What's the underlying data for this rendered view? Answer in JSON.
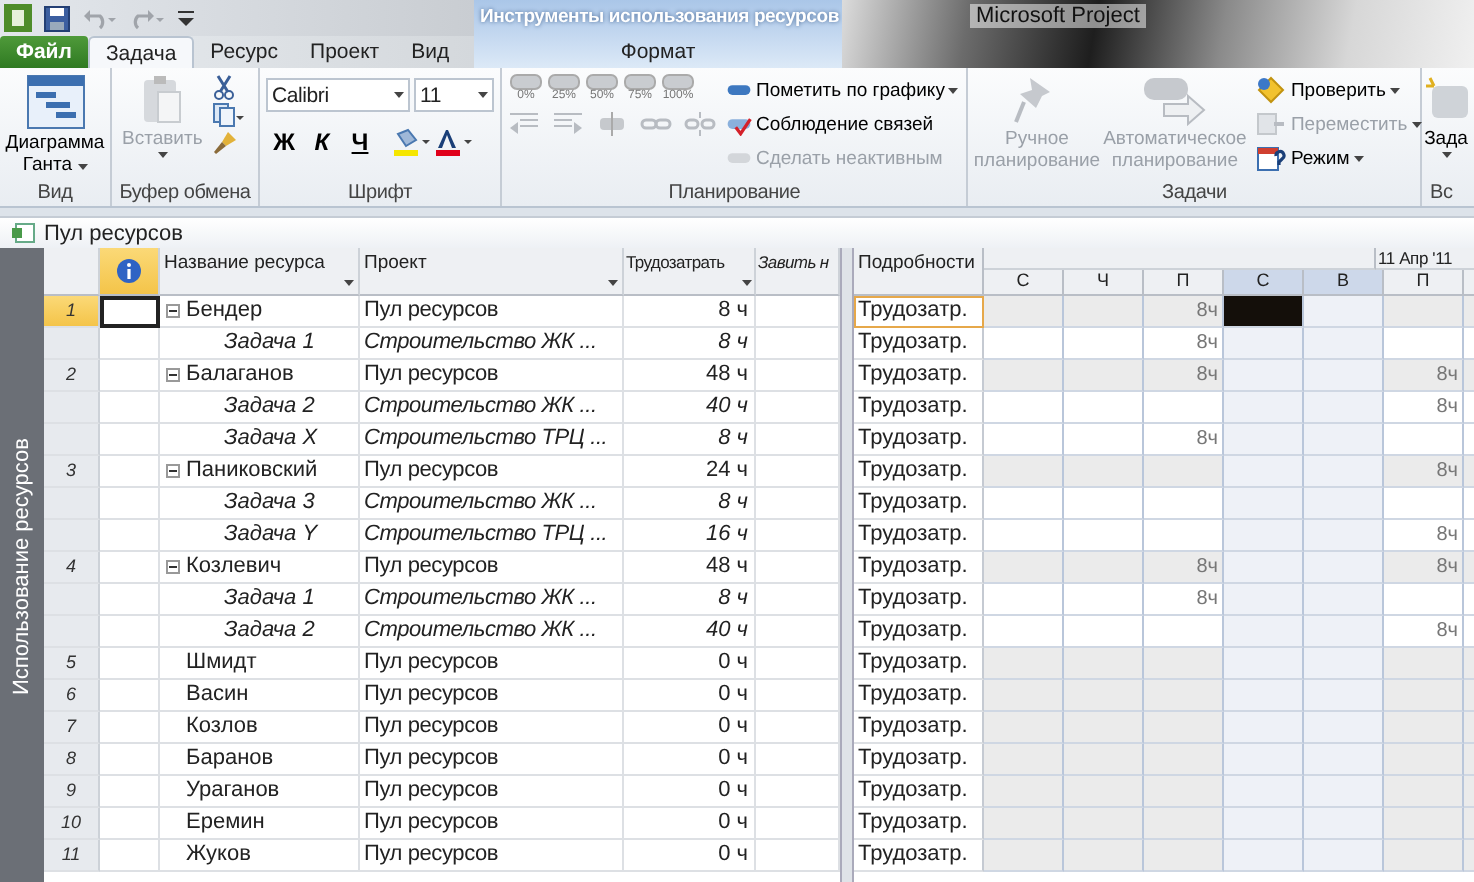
{
  "window": {
    "title": "Microsoft Project"
  },
  "contextual_group": {
    "title": "Инструменты использования ресурсов"
  },
  "tabs": [
    {
      "label": "Файл",
      "kind": "file",
      "selected": false
    },
    {
      "label": "Задача",
      "kind": "normal",
      "selected": true
    },
    {
      "label": "Ресурс",
      "kind": "normal",
      "selected": false
    },
    {
      "label": "Проект",
      "kind": "normal",
      "selected": false
    },
    {
      "label": "Вид",
      "kind": "normal",
      "selected": false
    },
    {
      "label": "Формат",
      "kind": "contextual",
      "selected": false
    }
  ],
  "ribbon": {
    "groups": [
      {
        "kind": "view",
        "label": "Вид",
        "button": {
          "label": "Диаграмма Ганта",
          "dropdown": true
        }
      },
      {
        "kind": "clipboard",
        "label": "Буфер обмена",
        "paste": {
          "label": "Вставить",
          "disabled": true
        }
      },
      {
        "kind": "font",
        "label": "Шрифт",
        "font": "Calibri",
        "size": "11",
        "bold": "Ж",
        "italic": "К",
        "underline": "Ч"
      },
      {
        "kind": "schedule",
        "label": "Планирование",
        "percents": [
          "0%",
          "25%",
          "50%",
          "75%",
          "100%"
        ],
        "commands": [
          {
            "label": "Пометить по графику",
            "dropdown": true,
            "disabled": false
          },
          {
            "label": "Соблюдение связей",
            "dropdown": false,
            "disabled": false
          },
          {
            "label": "Сделать неактивным",
            "dropdown": false,
            "disabled": true
          }
        ]
      },
      {
        "kind": "tasks",
        "label": "Задачи",
        "large": [
          {
            "label": "Ручное планирование",
            "disabled": true
          },
          {
            "label": "Автоматическое планирование",
            "disabled": true
          }
        ],
        "commands": [
          {
            "label": "Проверить",
            "dropdown": true,
            "disabled": false
          },
          {
            "label": "Переместить",
            "dropdown": true,
            "disabled": true
          },
          {
            "label": "Режим",
            "dropdown": true,
            "disabled": false
          }
        ]
      },
      {
        "kind": "insert",
        "label": "Вс",
        "button": {
          "label": "Зада",
          "dropdown": true
        }
      }
    ]
  },
  "view_bar": {
    "title": "Пул ресурсов"
  },
  "side_label": "Использование ресурсов",
  "table": {
    "columns": [
      {
        "label": "Название ресурса",
        "dropdown": true
      },
      {
        "label": "Проект",
        "dropdown": true
      },
      {
        "label": "Трудозатрать",
        "dropdown": true
      },
      {
        "label": "Завить н",
        "dropdown": false
      }
    ],
    "details_header": "Подробности",
    "week_label": "11 Апр '11",
    "days": [
      {
        "label": "С",
        "weekend": false
      },
      {
        "label": "Ч",
        "weekend": false
      },
      {
        "label": "П",
        "weekend": false
      },
      {
        "label": "С",
        "weekend": true
      },
      {
        "label": "В",
        "weekend": true
      },
      {
        "label": "П",
        "weekend": false
      }
    ],
    "rows": [
      {
        "num": "1",
        "kind": "resource",
        "expanded": true,
        "name": "Бендер",
        "project": "Пул ресурсов",
        "work": "8 ч",
        "details": "Трудозатр.",
        "selected": true,
        "cells": [
          null,
          null,
          "8ч",
          {
            "selected": true
          },
          null,
          null
        ]
      },
      {
        "kind": "assignment",
        "name": "Задача 1",
        "project": "Строительство ЖК ...",
        "work": "8 ч",
        "details": "Трудозатр.",
        "selected": false,
        "cells": [
          null,
          null,
          "8ч",
          null,
          null,
          null
        ]
      },
      {
        "num": "2",
        "kind": "resource",
        "expanded": true,
        "name": "Балаганов",
        "project": "Пул ресурсов",
        "work": "48 ч",
        "details": "Трудозатр.",
        "selected": false,
        "cells": [
          null,
          null,
          "8ч",
          null,
          null,
          "8ч"
        ]
      },
      {
        "kind": "assignment",
        "name": "Задача 2",
        "project": "Строительство ЖК ...",
        "work": "40 ч",
        "details": "Трудозатр.",
        "selected": false,
        "cells": [
          null,
          null,
          null,
          null,
          null,
          "8ч"
        ]
      },
      {
        "kind": "assignment",
        "name": "Задача X",
        "project": "Строительство ТРЦ ...",
        "work": "8 ч",
        "details": "Трудозатр.",
        "selected": false,
        "cells": [
          null,
          null,
          "8ч",
          null,
          null,
          null
        ]
      },
      {
        "num": "3",
        "kind": "resource",
        "expanded": true,
        "name": "Паниковский",
        "project": "Пул ресурсов",
        "work": "24 ч",
        "details": "Трудозатр.",
        "selected": false,
        "cells": [
          null,
          null,
          null,
          null,
          null,
          "8ч"
        ]
      },
      {
        "kind": "assignment",
        "name": "Задача 3",
        "project": "Строительство ЖК ...",
        "work": "8 ч",
        "details": "Трудозатр.",
        "selected": false,
        "cells": [
          null,
          null,
          null,
          null,
          null,
          null
        ]
      },
      {
        "kind": "assignment",
        "name": "Задача Y",
        "project": "Строительство ТРЦ ...",
        "work": "16 ч",
        "details": "Трудозатр.",
        "selected": false,
        "cells": [
          null,
          null,
          null,
          null,
          null,
          "8ч"
        ]
      },
      {
        "num": "4",
        "kind": "resource",
        "expanded": true,
        "name": "Козлевич",
        "project": "Пул ресурсов",
        "work": "48 ч",
        "details": "Трудозатр.",
        "selected": false,
        "cells": [
          null,
          null,
          "8ч",
          null,
          null,
          "8ч"
        ]
      },
      {
        "kind": "assignment",
        "name": "Задача 1",
        "project": "Строительство ЖК ...",
        "work": "8 ч",
        "details": "Трудозатр.",
        "selected": false,
        "cells": [
          null,
          null,
          "8ч",
          null,
          null,
          null
        ]
      },
      {
        "kind": "assignment",
        "name": "Задача 2",
        "project": "Строительство ЖК ...",
        "work": "40 ч",
        "details": "Трудозатр.",
        "selected": false,
        "cells": [
          null,
          null,
          null,
          null,
          null,
          "8ч"
        ]
      },
      {
        "num": "5",
        "kind": "resource",
        "name": "Шмидт",
        "project": "Пул ресурсов",
        "work": "0 ч",
        "details": "Трудозатр.",
        "selected": false,
        "cells": [
          null,
          null,
          null,
          null,
          null,
          null
        ]
      },
      {
        "num": "6",
        "kind": "resource",
        "name": "Васин",
        "project": "Пул ресурсов",
        "work": "0 ч",
        "details": "Трудозатр.",
        "selected": false,
        "cells": [
          null,
          null,
          null,
          null,
          null,
          null
        ]
      },
      {
        "num": "7",
        "kind": "resource",
        "name": "Козлов",
        "project": "Пул ресурсов",
        "work": "0 ч",
        "details": "Трудозатр.",
        "selected": false,
        "cells": [
          null,
          null,
          null,
          null,
          null,
          null
        ]
      },
      {
        "num": "8",
        "kind": "resource",
        "name": "Баранов",
        "project": "Пул ресурсов",
        "work": "0 ч",
        "details": "Трудозатр.",
        "selected": false,
        "cells": [
          null,
          null,
          null,
          null,
          null,
          null
        ]
      },
      {
        "num": "9",
        "kind": "resource",
        "name": "Ураганов",
        "project": "Пул ресурсов",
        "work": "0 ч",
        "details": "Трудозатр.",
        "selected": false,
        "cells": [
          null,
          null,
          null,
          null,
          null,
          null
        ]
      },
      {
        "num": "10",
        "kind": "resource",
        "name": "Еремин",
        "project": "Пул ресурсов",
        "work": "0 ч",
        "details": "Трудозатр.",
        "selected": false,
        "cells": [
          null,
          null,
          null,
          null,
          null,
          null
        ]
      },
      {
        "num": "11",
        "kind": "resource",
        "name": "Жуков",
        "project": "Пул ресурсов",
        "work": "0 ч",
        "details": "Трудозатр.",
        "selected": false,
        "cells": [
          null,
          null,
          null,
          null,
          null,
          null
        ]
      }
    ]
  }
}
